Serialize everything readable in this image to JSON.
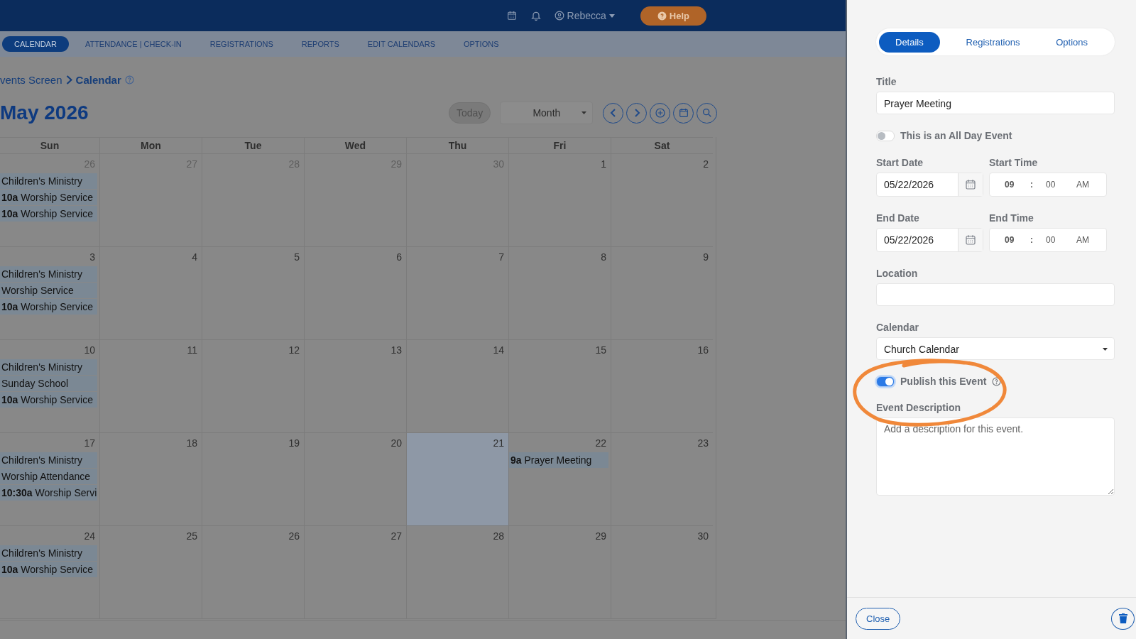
{
  "top_bar": {
    "user": "Rebecca",
    "help": "Help"
  },
  "nav_tabs": [
    {
      "label": "CALENDAR",
      "selected": true
    },
    {
      "label": "ATTENDANCE | CHECK-IN",
      "selected": false
    },
    {
      "label": "REGISTRATIONS",
      "selected": false
    },
    {
      "label": "REPORTS",
      "selected": false
    },
    {
      "label": "EDIT CALENDARS",
      "selected": false
    },
    {
      "label": "OPTIONS",
      "selected": false
    }
  ],
  "breadcrumb": {
    "parent": "vents Screen",
    "current": "Calendar"
  },
  "month_title": "May 2026",
  "toolbar": {
    "today": "Today",
    "view": "Month"
  },
  "calendar": {
    "weekdays": [
      "Sun",
      "Mon",
      "Tue",
      "Wed",
      "Thu",
      "Fri",
      "Sat"
    ],
    "weeks": [
      {
        "days": [
          {
            "date": "26",
            "other_month": true,
            "today": false,
            "events": [
              {
                "title": "Children's Ministry"
              },
              {
                "time": "10a",
                "title": "Worship Service"
              },
              {
                "time": "10a",
                "title": "Worship Service"
              }
            ]
          },
          {
            "date": "27",
            "other_month": true,
            "today": false
          },
          {
            "date": "28",
            "other_month": true,
            "today": false
          },
          {
            "date": "29",
            "other_month": true,
            "today": false
          },
          {
            "date": "30",
            "other_month": true,
            "today": false
          },
          {
            "date": "1",
            "other_month": false,
            "today": false
          },
          {
            "date": "2",
            "other_month": false,
            "today": false
          }
        ]
      },
      {
        "days": [
          {
            "date": "3",
            "other_month": false,
            "today": false,
            "events": [
              {
                "title": "Children's Ministry"
              },
              {
                "title": "Worship Service"
              },
              {
                "time": "10a",
                "title": "Worship Service"
              }
            ]
          },
          {
            "date": "4",
            "other_month": false,
            "today": false
          },
          {
            "date": "5",
            "other_month": false,
            "today": false
          },
          {
            "date": "6",
            "other_month": false,
            "today": false
          },
          {
            "date": "7",
            "other_month": false,
            "today": false
          },
          {
            "date": "8",
            "other_month": false,
            "today": false
          },
          {
            "date": "9",
            "other_month": false,
            "today": false
          }
        ]
      },
      {
        "days": [
          {
            "date": "10",
            "other_month": false,
            "today": false,
            "events": [
              {
                "title": "Children's Ministry"
              },
              {
                "title": "Sunday School"
              },
              {
                "time": "10a",
                "title": "Worship Service"
              }
            ]
          },
          {
            "date": "11",
            "other_month": false,
            "today": false
          },
          {
            "date": "12",
            "other_month": false,
            "today": false
          },
          {
            "date": "13",
            "other_month": false,
            "today": false
          },
          {
            "date": "14",
            "other_month": false,
            "today": false
          },
          {
            "date": "15",
            "other_month": false,
            "today": false
          },
          {
            "date": "16",
            "other_month": false,
            "today": false
          }
        ]
      },
      {
        "days": [
          {
            "date": "17",
            "other_month": false,
            "today": false,
            "events": [
              {
                "title": "Children's Ministry"
              },
              {
                "title": "Worship Attendance"
              },
              {
                "time": "10:30a",
                "title": "Worship Servi"
              }
            ]
          },
          {
            "date": "18",
            "other_month": false,
            "today": false
          },
          {
            "date": "19",
            "other_month": false,
            "today": false
          },
          {
            "date": "20",
            "other_month": false,
            "today": false
          },
          {
            "date": "21",
            "other_month": false,
            "today": true
          },
          {
            "date": "22",
            "other_month": false,
            "today": false,
            "events": [
              {
                "time": "9a",
                "title": "Prayer Meeting"
              }
            ]
          },
          {
            "date": "23",
            "other_month": false,
            "today": false
          }
        ]
      },
      {
        "days": [
          {
            "date": "24",
            "other_month": false,
            "today": false,
            "events": [
              {
                "title": "Children's Ministry"
              },
              {
                "time": "10a",
                "title": "Worship Service"
              }
            ]
          },
          {
            "date": "25",
            "other_month": false,
            "today": false
          },
          {
            "date": "26",
            "other_month": false,
            "today": false
          },
          {
            "date": "27",
            "other_month": false,
            "today": false
          },
          {
            "date": "28",
            "other_month": false,
            "today": false
          },
          {
            "date": "29",
            "other_month": false,
            "today": false
          },
          {
            "date": "30",
            "other_month": false,
            "today": false
          }
        ]
      }
    ]
  },
  "panel": {
    "tabs": [
      {
        "label": "Details",
        "selected": true
      },
      {
        "label": "Registrations",
        "selected": false
      },
      {
        "label": "Options",
        "selected": false
      }
    ],
    "title": {
      "label": "Title",
      "value": "Prayer Meeting"
    },
    "all_day": {
      "label": "This is an All Day Event",
      "on": false
    },
    "start": {
      "date_label": "Start Date",
      "date": "05/22/2026",
      "time_label": "Start Time",
      "hour": "09",
      "separator": ":",
      "minute": "00",
      "ampm": "AM"
    },
    "end": {
      "date_label": "End Date",
      "date": "05/22/2026",
      "time_label": "End Time",
      "hour": "09",
      "separator": ":",
      "minute": "00",
      "ampm": "AM"
    },
    "location": {
      "label": "Location"
    },
    "calendar": {
      "label": "Calendar",
      "value": "Church Calendar"
    },
    "publish": {
      "label": "Publish this Event",
      "on": true
    },
    "description": {
      "label": "Event Description",
      "placeholder": "Add a description for this event."
    },
    "close": "Close"
  }
}
